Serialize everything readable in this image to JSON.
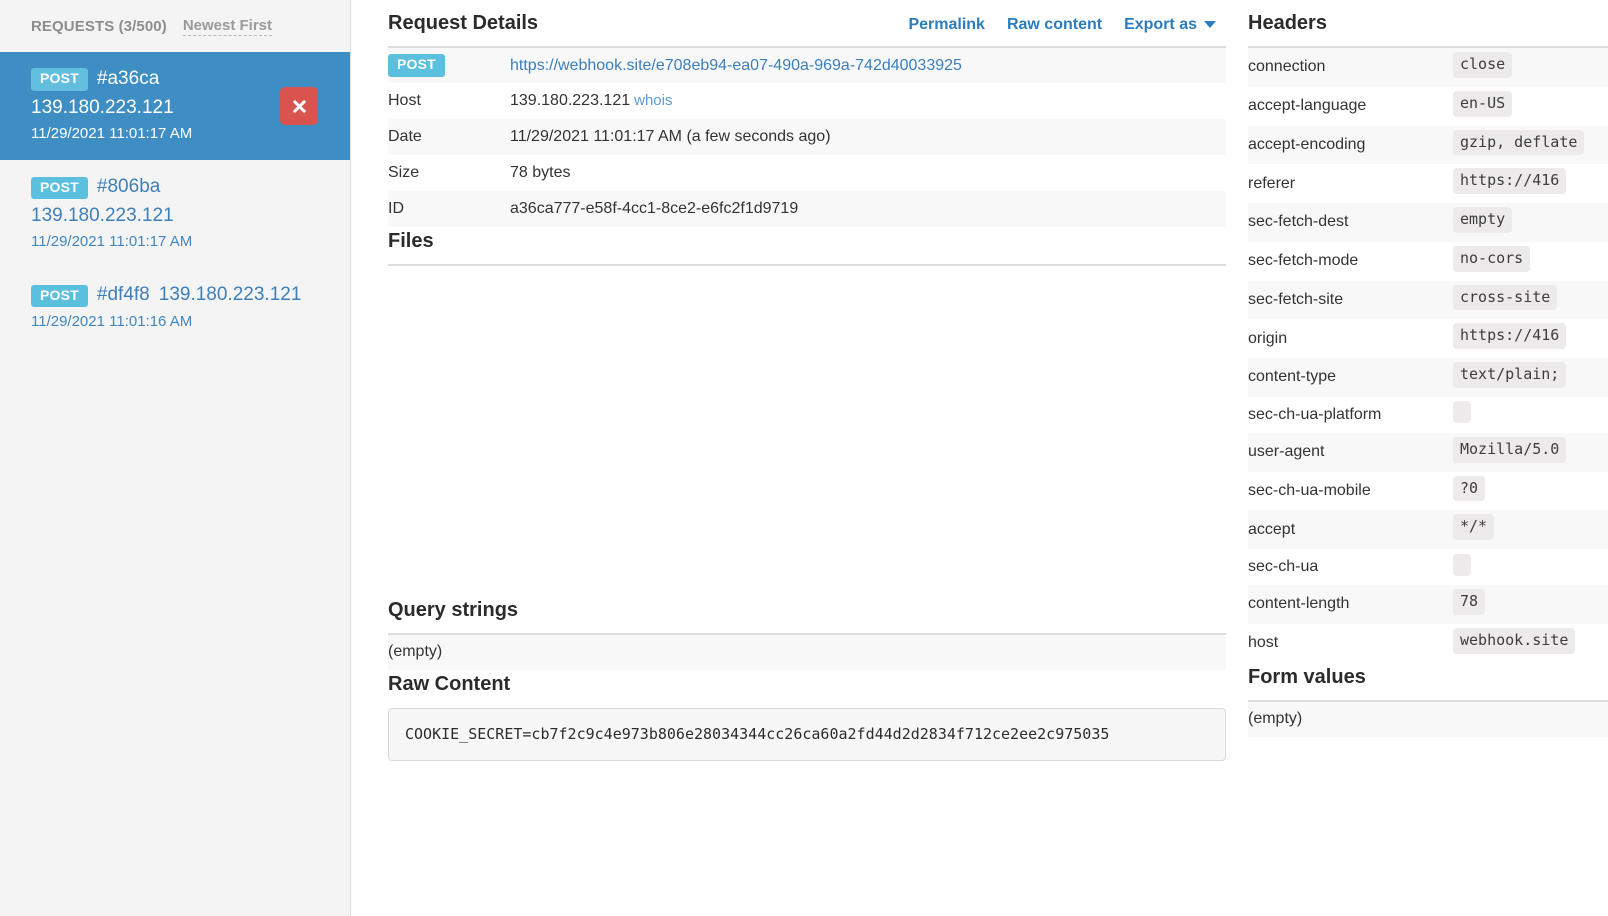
{
  "sidebar": {
    "requests_label": "REQUESTS (3/500)",
    "sort_label": "Newest First",
    "delete_icon": "close-x-icon",
    "items": [
      {
        "method": "POST",
        "id": "#a36ca",
        "host": "139.180.223.121",
        "time": "11/29/2021 11:01:17 AM",
        "selected": true,
        "inline": false
      },
      {
        "method": "POST",
        "id": "#806ba",
        "host": "139.180.223.121",
        "time": "11/29/2021 11:01:17 AM",
        "selected": false,
        "inline": false
      },
      {
        "method": "POST",
        "id": "#df4f8",
        "host": "139.180.223.121",
        "time": "11/29/2021 11:01:16 AM",
        "selected": false,
        "inline": true
      }
    ]
  },
  "details": {
    "title": "Request Details",
    "actions": {
      "permalink": "Permalink",
      "raw_content": "Raw content",
      "export_as": "Export as",
      "caret_icon": "chevron-down-icon"
    },
    "method": "POST",
    "url": "https://webhook.site/e708eb94-ea07-490a-969a-742d40033925",
    "rows": [
      {
        "key": "Host",
        "value": "139.180.223.121",
        "link": "whois"
      },
      {
        "key": "Date",
        "value": "11/29/2021 11:01:17 AM (a few seconds ago)"
      },
      {
        "key": "Size",
        "value": "78 bytes"
      },
      {
        "key": "ID",
        "value": "a36ca777-e58f-4cc1-8ce2-e6fc2f1d9719"
      }
    ]
  },
  "files": {
    "title": "Files",
    "content": ""
  },
  "query_strings": {
    "title": "Query strings",
    "empty_label": "(empty)"
  },
  "form_values": {
    "title": "Form values",
    "empty_label": "(empty)"
  },
  "raw_content": {
    "title": "Raw Content",
    "body": "COOKIE_SECRET=cb7f2c9c4e973b806e28034344cc26ca60a2fd44d2d2834f712ce2ee2c975035"
  },
  "headers": {
    "title": "Headers",
    "rows": [
      {
        "key": "connection",
        "value": "close"
      },
      {
        "key": "accept-language",
        "value": "en-US"
      },
      {
        "key": "accept-encoding",
        "value": "gzip, deflate"
      },
      {
        "key": "referer",
        "value": "https://416"
      },
      {
        "key": "sec-fetch-dest",
        "value": "empty"
      },
      {
        "key": "sec-fetch-mode",
        "value": "no-cors"
      },
      {
        "key": "sec-fetch-site",
        "value": "cross-site"
      },
      {
        "key": "origin",
        "value": "https://416"
      },
      {
        "key": "content-type",
        "value": "text/plain;"
      },
      {
        "key": "sec-ch-ua-platform",
        "value": ""
      },
      {
        "key": "user-agent",
        "value": "Mozilla/5.0"
      },
      {
        "key": "sec-ch-ua-mobile",
        "value": "?0"
      },
      {
        "key": "accept",
        "value": "*/*"
      },
      {
        "key": "sec-ch-ua",
        "value": ""
      },
      {
        "key": "content-length",
        "value": "78"
      },
      {
        "key": "host",
        "value": "webhook.site"
      }
    ]
  },
  "colors": {
    "accent_blue": "#3e8ec4",
    "badge_blue": "#5bc0de",
    "link_blue": "#2c7cbe",
    "danger_red": "#d9534f",
    "sidebar_bg": "#f4f4f4",
    "row_alt_bg": "#f8f8f8"
  }
}
